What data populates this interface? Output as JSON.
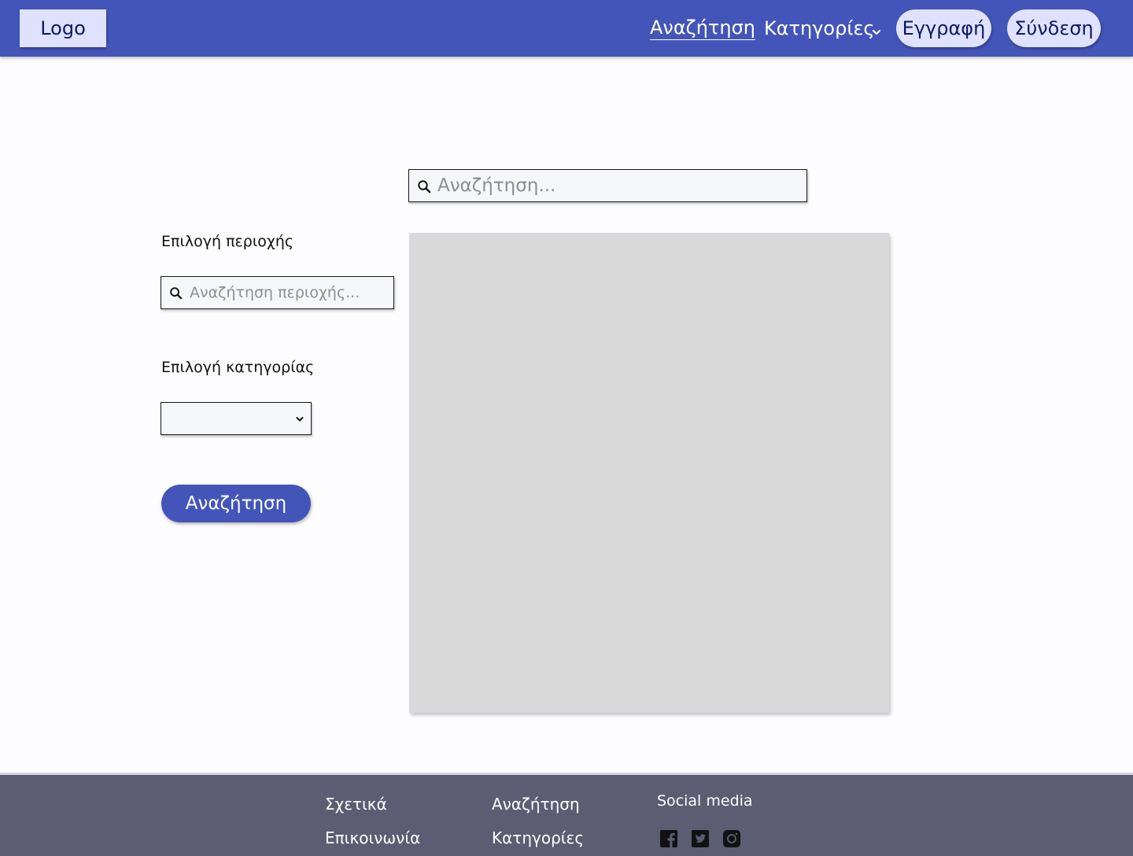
{
  "header": {
    "logo": "Logo",
    "nav": {
      "search": "Αναζήτηση",
      "categories": "Κατηγορίες"
    },
    "register": "Εγγραφή",
    "login": "Σύνδεση"
  },
  "main": {
    "search_placeholder": "Αναζήτηση..."
  },
  "sidebar": {
    "region_label": "Επιλογή περιοχής",
    "region_placeholder": "Αναζήτηση περιοχής...",
    "category_label": "Επιλογή κατηγορίας",
    "category_value": "",
    "search_button": "Αναζήτηση"
  },
  "footer": {
    "about": "Σχετικά",
    "contact": "Επικοινωνία",
    "search": "Αναζήτηση",
    "categories": "Κατηγορίες",
    "social_title": "Social media",
    "social_icons": [
      "facebook-icon",
      "twitter-icon",
      "instagram-icon"
    ]
  },
  "colors": {
    "primary": "#4355b8",
    "pill_bg": "#dfe2ff",
    "footer_bg": "#5c5c72",
    "placeholder_area": "#d9d9d9"
  }
}
